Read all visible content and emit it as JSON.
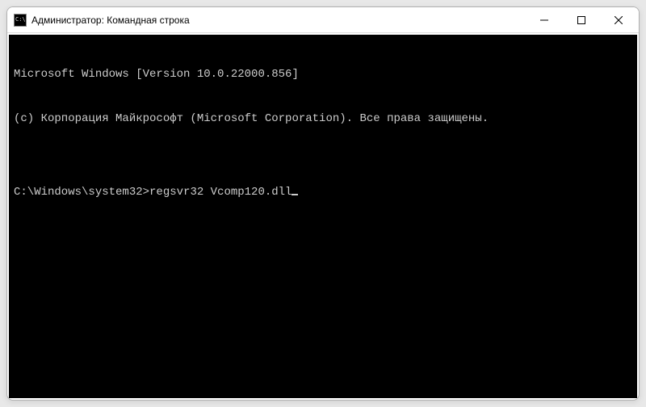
{
  "titlebar": {
    "title": "Администратор: Командная строка"
  },
  "terminal": {
    "line1": "Microsoft Windows [Version 10.0.22000.856]",
    "line2": "(c) Корпорация Майкрософт (Microsoft Corporation). Все права защищены.",
    "blank": "",
    "prompt": "C:\\Windows\\system32>",
    "command": "regsvr32 Vcomp120.dll"
  }
}
